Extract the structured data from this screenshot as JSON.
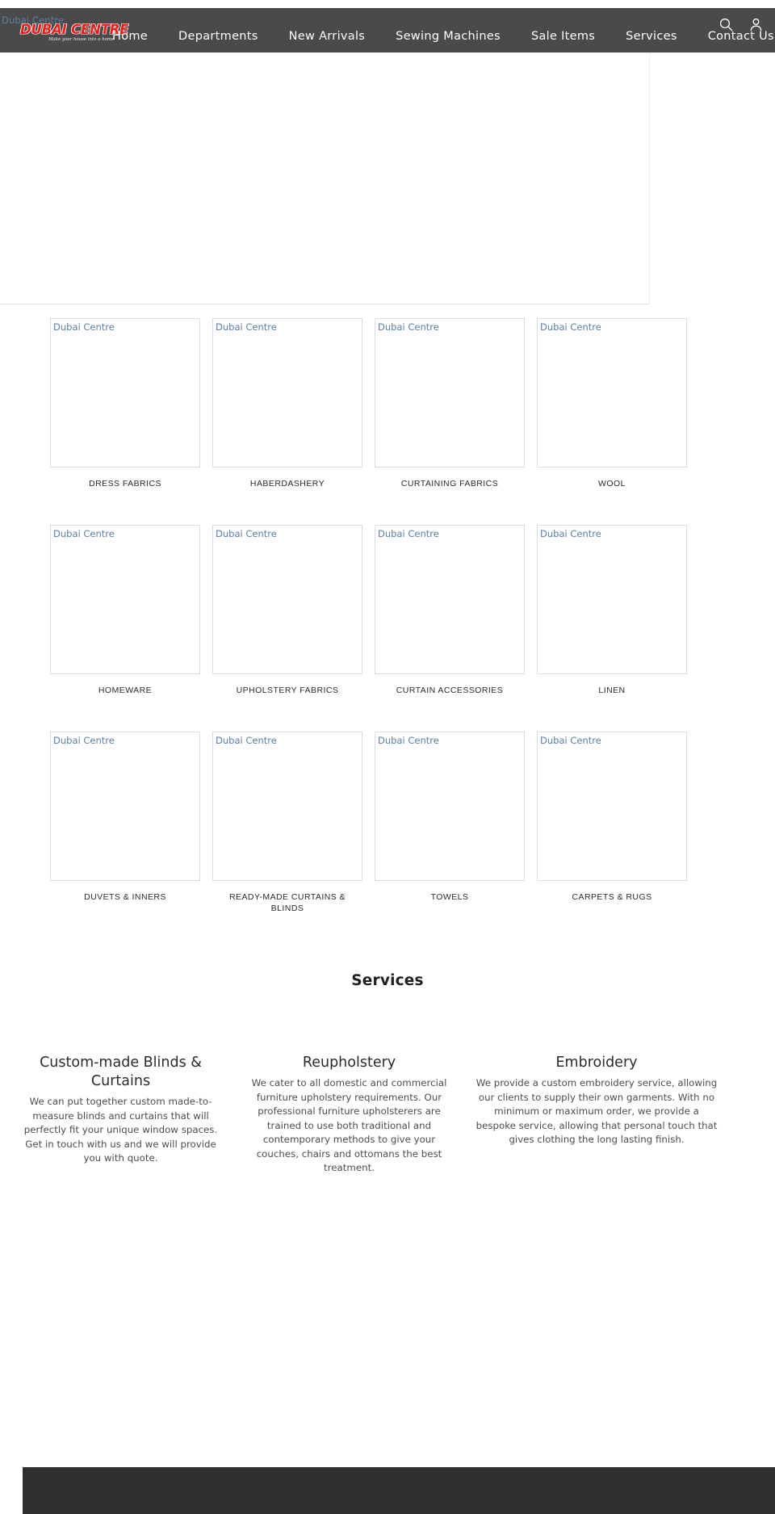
{
  "site": {
    "title": "Dubai Centre",
    "logo_alt": "Dubai Centre",
    "logo_word": "DUBAI CENTRE",
    "logo_tagline": "Make your house into a home",
    "brand_red": "#e8201c",
    "header_bg": "#4a4a4a",
    "footer_bg": "#2f2f2f"
  },
  "nav": {
    "items": [
      {
        "label": "Home"
      },
      {
        "label": "Departments"
      },
      {
        "label": "New Arrivals"
      },
      {
        "label": "Sewing Machines"
      },
      {
        "label": "Sale Items"
      },
      {
        "label": "Services"
      },
      {
        "label": "Contact Us"
      }
    ],
    "icons": [
      {
        "name": "search-icon",
        "label": "Search"
      },
      {
        "name": "account-icon",
        "label": "Account"
      }
    ]
  },
  "hero": {
    "alt": ""
  },
  "categories": {
    "broken_image_alt": "Dubai Centre",
    "rows": [
      [
        {
          "label": "DRESS FABRICS",
          "alt": "Dubai Centre"
        },
        {
          "label": "HABERDASHERY",
          "alt": "Dubai Centre"
        },
        {
          "label": "CURTAINING FABRICS",
          "alt": "Dubai Centre"
        },
        {
          "label": "WOOL",
          "alt": "Dubai Centre"
        }
      ],
      [
        {
          "label": "HOMEWARE",
          "alt": "Dubai Centre"
        },
        {
          "label": "UPHOLSTERY FABRICS",
          "alt": "Dubai Centre"
        },
        {
          "label": "CURTAIN ACCESSORIES",
          "alt": "Dubai Centre"
        },
        {
          "label": "LINEN",
          "alt": "Dubai Centre"
        }
      ],
      [
        {
          "label": "DUVETS & INNERS",
          "alt": "Dubai Centre"
        },
        {
          "label": "READY-MADE CURTAINS & BLINDS",
          "alt": "Dubai Centre"
        },
        {
          "label": "TOWELS",
          "alt": "Dubai Centre"
        },
        {
          "label": "CARPETS & RUGS",
          "alt": "Dubai Centre"
        }
      ]
    ]
  },
  "services": {
    "title": "Services",
    "items": [
      {
        "heading": "Custom-made Blinds & Curtains",
        "body": "We can put together custom made-to-measure blinds and curtains that will perfectly fit your unique window spaces. Get in touch with us and we will provide you with quote."
      },
      {
        "heading": "Reupholstery",
        "body": "We cater to all domestic and commercial furniture upholstery requirements. Our professional furniture upholsterers are trained to use both traditional and contemporary methods to give your couches, chairs and ottomans the best treatment."
      },
      {
        "heading": "Embroidery",
        "body": "We provide a custom embroidery service, allowing our clients to supply their own garments. With no minimum or maximum order, we provide a bespoke service, allowing that personal touch that gives clothing the long lasting finish."
      }
    ]
  }
}
